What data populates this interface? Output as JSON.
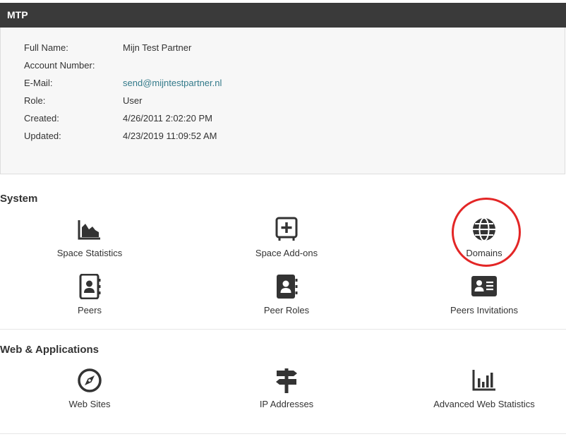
{
  "header": {
    "title": "MTP"
  },
  "account": {
    "rows": [
      {
        "label": "Full Name:",
        "value": "Mijn Test Partner"
      },
      {
        "label": "Account Number:",
        "value": ""
      },
      {
        "label": "E-Mail:",
        "value": "send@mijntestpartner.nl"
      },
      {
        "label": "Role:",
        "value": "User"
      },
      {
        "label": "Created:",
        "value": "4/26/2011 2:02:20 PM"
      },
      {
        "label": "Updated:",
        "value": "4/23/2019 11:09:52 AM"
      }
    ]
  },
  "system": {
    "title": "System",
    "tiles": [
      {
        "label": "Space Statistics",
        "icon": "area-chart-icon"
      },
      {
        "label": "Space Add-ons",
        "icon": "plus-square-icon"
      },
      {
        "label": "Domains",
        "icon": "globe-icon"
      },
      {
        "label": "Peers",
        "icon": "contact-book-icon"
      },
      {
        "label": "Peer Roles",
        "icon": "contact-book-solid-icon"
      },
      {
        "label": "Peers Invitations",
        "icon": "id-card-icon"
      }
    ]
  },
  "web": {
    "title": "Web & Applications",
    "tiles": [
      {
        "label": "Web Sites",
        "icon": "compass-icon"
      },
      {
        "label": "IP Addresses",
        "icon": "signpost-icon"
      },
      {
        "label": "Advanced Web Statistics",
        "icon": "bar-chart-icon"
      }
    ]
  },
  "colors": {
    "header_bg": "#3a3a3a",
    "link": "#337a8a",
    "highlight": "#e32626",
    "icon": "#333333"
  }
}
